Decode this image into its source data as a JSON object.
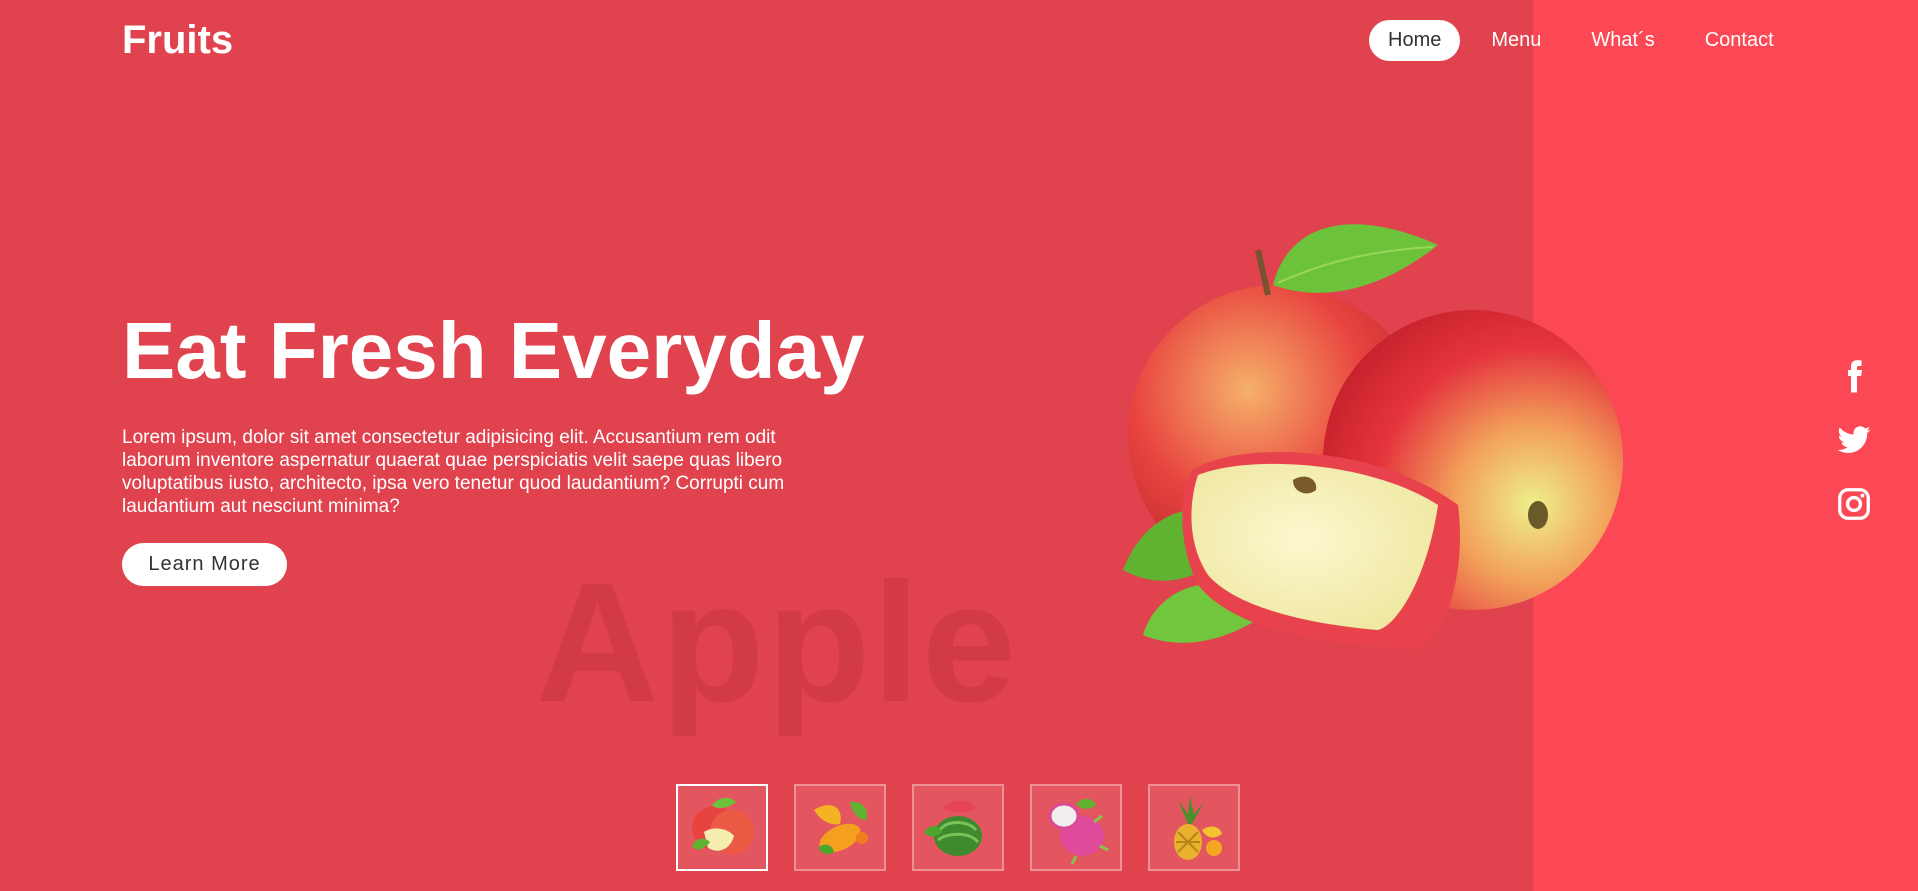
{
  "header": {
    "logo": "Fruits",
    "nav": [
      {
        "label": "Home",
        "active": true
      },
      {
        "label": "Menu"
      },
      {
        "label": "What´s"
      },
      {
        "label": "Contact"
      }
    ]
  },
  "hero": {
    "title": "Eat Fresh Everyday",
    "text": "Lorem ipsum, dolor sit amet consectetur adipisicing elit. Accusantium rem odit laborum inventore aspernatur quaerat quae perspiciatis velit saepe quas libero voluptatibus iusto, architecto, ipsa vero tenetur quod laudantium? Corrupti cum laudantium aut nesciunt minima?",
    "button": "Learn More",
    "watermark": "Apple"
  },
  "social": [
    "facebook-icon",
    "twitter-icon",
    "instagram-icon"
  ],
  "thumbnails": [
    "apple",
    "mango",
    "watermelon",
    "dragon-fruit",
    "pineapple"
  ],
  "colors": {
    "background": "#e0434e",
    "panel": "#fb4854"
  }
}
